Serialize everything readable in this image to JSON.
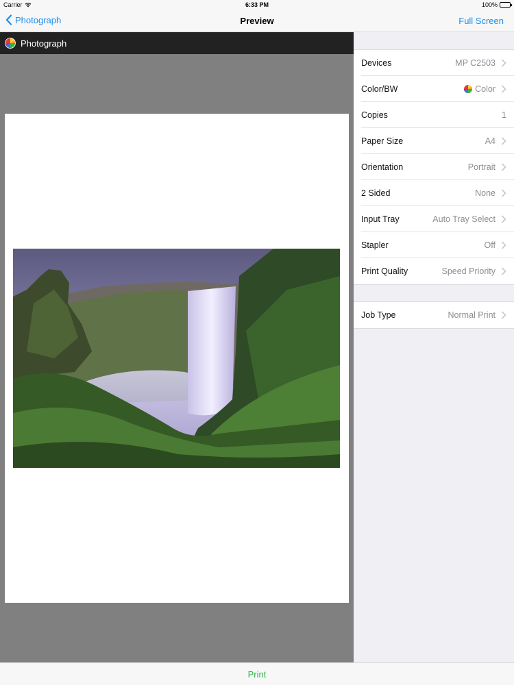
{
  "status_bar": {
    "carrier": "Carrier",
    "time": "6:33 PM",
    "battery": "100%"
  },
  "nav": {
    "back_label": "Photograph",
    "title": "Preview",
    "right_label": "Full Screen"
  },
  "preview": {
    "document_title": "Photograph"
  },
  "settings": {
    "group1": [
      {
        "label": "Devices",
        "value": "MP C2503"
      },
      {
        "label": "Color/BW",
        "value": "Color",
        "icon": "color-wheel-icon"
      },
      {
        "label": "Copies",
        "value": "1"
      },
      {
        "label": "Paper Size",
        "value": "A4"
      },
      {
        "label": "Orientation",
        "value": "Portrait"
      },
      {
        "label": "2 Sided",
        "value": "None"
      },
      {
        "label": "Input Tray",
        "value": "Auto Tray Select"
      },
      {
        "label": "Stapler",
        "value": "Off"
      },
      {
        "label": "Print Quality",
        "value": "Speed Priority"
      }
    ],
    "group2": [
      {
        "label": "Job Type",
        "value": "Normal Print"
      }
    ]
  },
  "toolbar": {
    "print_label": "Print"
  },
  "colors": {
    "accent": "#1a8ef0",
    "print_green": "#2fb34a",
    "header_dark": "#222222",
    "preview_gray": "#808080"
  }
}
